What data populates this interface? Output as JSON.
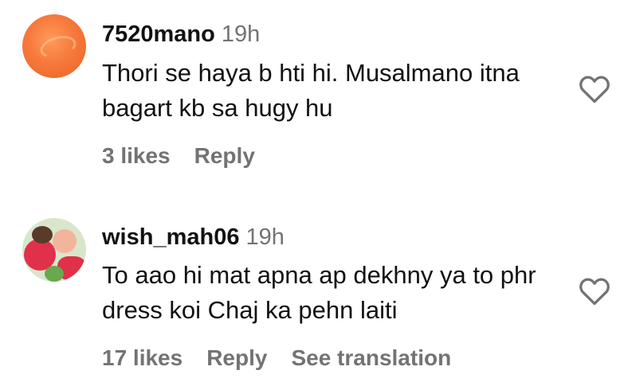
{
  "comments": [
    {
      "username": "7520mano",
      "time": "19h",
      "text": "Thori se haya b hti hi. Musalmano itna bagart kb sa hugy hu",
      "likes": "3 likes",
      "reply": "Reply",
      "icons": {
        "avatar": "orange-avatar",
        "like": "heart-outline-icon"
      }
    },
    {
      "username": "wish_mah06",
      "time": "19h",
      "text": "To aao hi mat apna ap dekhny ya to phr dress koi Chaj ka pehn laiti",
      "likes": "17 likes",
      "reply": "Reply",
      "translation": "See translation",
      "icons": {
        "avatar": "photo-avatar",
        "like": "heart-outline-icon"
      }
    }
  ],
  "colors": {
    "text": "#111111",
    "secondary": "#737373",
    "background": "#ffffff"
  }
}
